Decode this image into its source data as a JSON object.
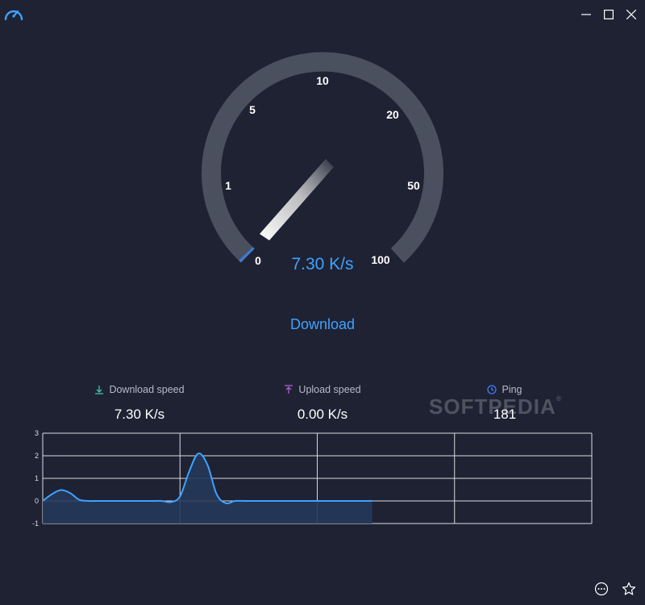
{
  "app": {
    "icon": "speedometer-icon"
  },
  "window_controls": [
    {
      "name": "minimize-button",
      "icon": "minimize-icon"
    },
    {
      "name": "maximize-button",
      "icon": "maximize-icon"
    },
    {
      "name": "close-button",
      "icon": "close-icon"
    }
  ],
  "gauge": {
    "ticks": [
      "0",
      "1",
      "5",
      "10",
      "20",
      "50",
      "100"
    ],
    "speed_text": "7.30 K/s",
    "mode_label": "Download"
  },
  "stats": {
    "download": {
      "label": "Download speed",
      "value": "7.30 K/s",
      "icon": "download-icon",
      "color": "#3ec7a2"
    },
    "upload": {
      "label": "Upload speed",
      "value": "0.00 K/s",
      "icon": "upload-icon",
      "color": "#b062d6"
    },
    "ping": {
      "label": "Ping",
      "value": "181",
      "icon": "clock-icon",
      "color": "#3e7bff"
    }
  },
  "watermark": {
    "text": "SOFTPEDIA",
    "mark": "®"
  },
  "chart_data": {
    "type": "line",
    "ylim": [
      -1,
      3
    ],
    "yticks": [
      "3",
      "2",
      "1",
      "0",
      "-1"
    ],
    "x": [
      0,
      1,
      2,
      3,
      4,
      5,
      6,
      7,
      8,
      9,
      10,
      11,
      12,
      13,
      14,
      15,
      16,
      17,
      18,
      19,
      20,
      21,
      22,
      23,
      24,
      25,
      26,
      27,
      28,
      29,
      30,
      31,
      32,
      33,
      34,
      35,
      36
    ],
    "values": [
      0.0,
      0.3,
      0.48,
      0.35,
      0.05,
      0.0,
      0.0,
      0.0,
      0.0,
      0.0,
      0.0,
      0.0,
      0.0,
      0.0,
      -0.05,
      0.2,
      1.3,
      2.1,
      1.6,
      0.3,
      -0.1,
      0.0,
      0.0,
      0.0,
      0.0,
      0.0,
      0.0,
      0.0,
      0.0,
      0.0,
      0.0,
      0.0,
      0.0,
      0.0,
      0.0,
      0.0,
      0.0
    ],
    "xmax": 60,
    "grid": true,
    "line_color": "#3ea3ff",
    "fill_color": "#25395a"
  },
  "bottom_actions": [
    {
      "name": "more-button",
      "icon": "more-icon"
    },
    {
      "name": "favorite-button",
      "icon": "star-icon"
    }
  ],
  "colors": {
    "background": "#1f2233",
    "accent": "#3ea3ff",
    "gauge_track": "#4b505e"
  }
}
